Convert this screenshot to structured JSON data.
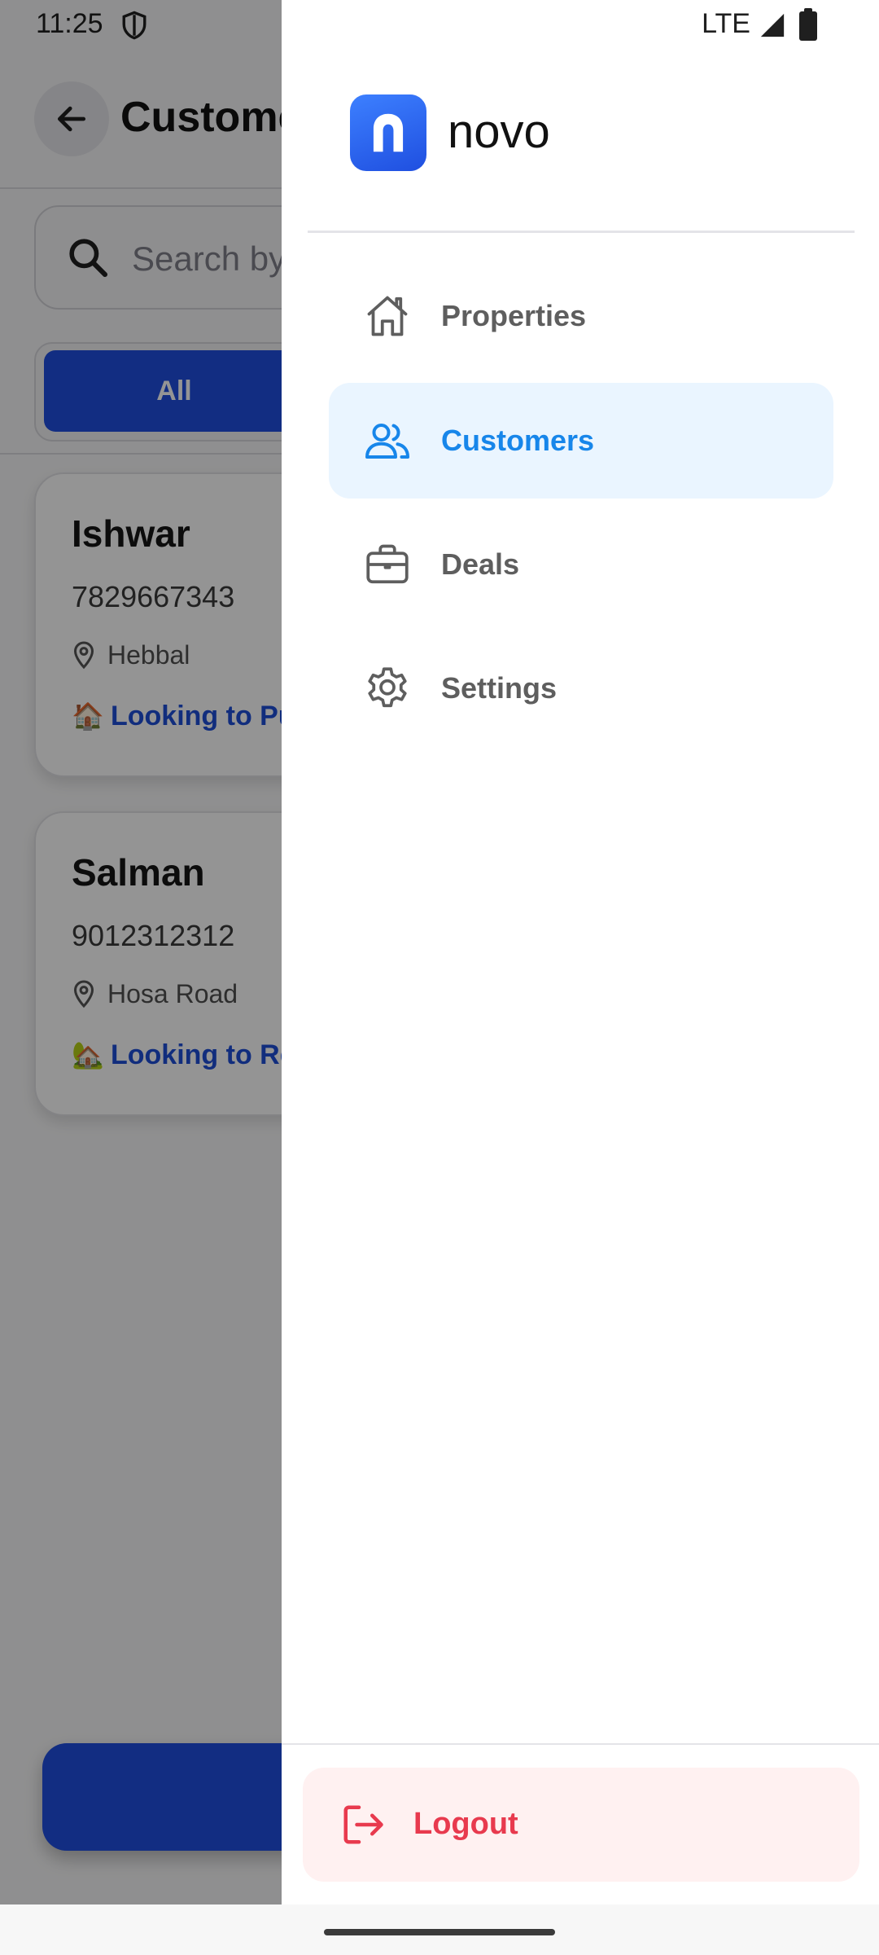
{
  "status": {
    "time": "11:25",
    "network": "LTE"
  },
  "header": {
    "title": "Customers"
  },
  "search": {
    "placeholder": "Search by"
  },
  "filters": {
    "all_label": "All"
  },
  "customers": [
    {
      "name": "Ishwar",
      "phone": "7829667343",
      "location": "Hebbal",
      "intent_emoji": "🏠",
      "intent": "Looking to Pur"
    },
    {
      "name": "Salman",
      "phone": "9012312312",
      "location": "Hosa Road",
      "intent_emoji": "🏡",
      "intent": "Looking to Ren"
    }
  ],
  "drawer": {
    "brand": "novo",
    "items": [
      {
        "label": "Properties",
        "icon": "home-icon",
        "active": false
      },
      {
        "label": "Customers",
        "icon": "users-icon",
        "active": true
      },
      {
        "label": "Deals",
        "icon": "briefcase-icon",
        "active": false
      },
      {
        "label": "Settings",
        "icon": "gear-icon",
        "active": false
      }
    ],
    "logout_label": "Logout"
  },
  "colors": {
    "primary": "#1f4fe0",
    "active_text": "#1786ea",
    "active_bg": "#eaf5ff",
    "logout_text": "#e83a4e",
    "logout_bg": "#fff1f1"
  }
}
